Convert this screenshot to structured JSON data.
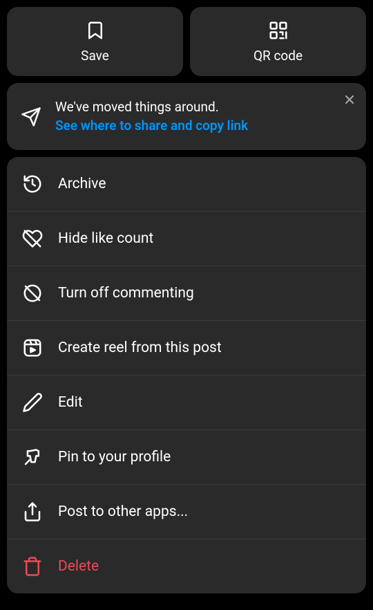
{
  "top": {
    "save_label": "Save",
    "qr_label": "QR code"
  },
  "banner": {
    "line1": "We've moved things around.",
    "line2": "See where to share and copy link"
  },
  "menu": {
    "archive": "Archive",
    "hide_likes": "Hide like count",
    "turn_off_commenting": "Turn off commenting",
    "create_reel": "Create reel from this post",
    "edit": "Edit",
    "pin": "Pin to your profile",
    "post_other": "Post to other apps...",
    "delete": "Delete"
  }
}
